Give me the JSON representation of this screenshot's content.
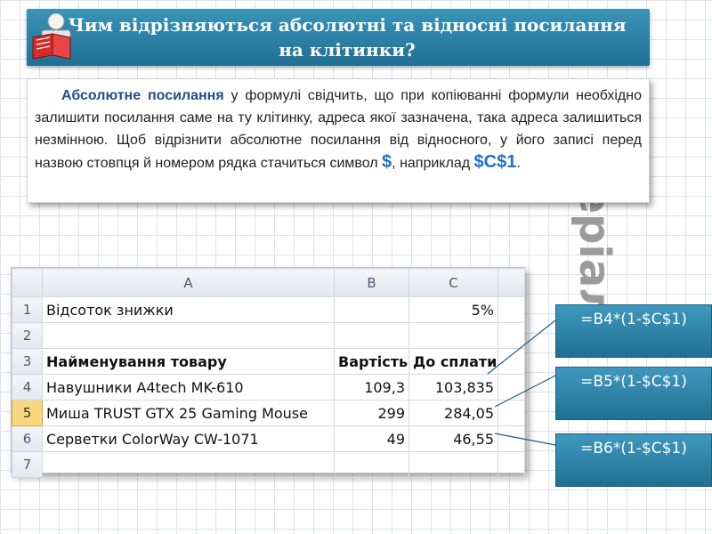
{
  "title": "Чим відрізняються абсолютні та відносні посилання на клітинки?",
  "side_label": "матеріалу",
  "definition": {
    "term": "Абсолютне посилання",
    "text1": " у формулі свідчить, що при копіюванні формули необхідно залишити посилання саме на ту клітинку, адреса якої зазначена, така адреса залишиться незмінною. Щоб відрізнити абсолютне посилання від відносного, у його записі перед назвою стовпця й номером рядка стачиться символ ",
    "symbol": "$",
    "text2": ", наприклад ",
    "example": "$C$1",
    "text3": "."
  },
  "spreadsheet": {
    "columns": [
      "A",
      "B",
      "C"
    ],
    "rows": [
      {
        "num": "1",
        "a": "Відсоток знижки",
        "b": "",
        "c": "5%"
      },
      {
        "num": "2",
        "a": "",
        "b": "",
        "c": ""
      },
      {
        "num": "3",
        "a": "Найменування товару",
        "b": "Вартість",
        "c": "До сплати"
      },
      {
        "num": "4",
        "a": "Навушники A4tech MK-610",
        "b": "109,3",
        "c": "103,835"
      },
      {
        "num": "5",
        "a": "Миша TRUST GTX 25 Gaming Mouse",
        "b": "299",
        "c": "284,05"
      },
      {
        "num": "6",
        "a": "Серветки ColorWay CW-1071",
        "b": "49",
        "c": "46,55"
      },
      {
        "num": "7",
        "a": "",
        "b": "",
        "c": ""
      }
    ],
    "active_row": "5"
  },
  "formulas": [
    "=B4*(1-$C$1)",
    "=B5*(1-$C$1)",
    "=B6*(1-$C$1)"
  ],
  "colors": {
    "title_bar": "#2a82a9",
    "formula_box": "#2a84ab",
    "term": "#1f4e8c",
    "symbol": "#1f6fd0",
    "active_row_header": "#f9d77e"
  },
  "icons": [
    "book-icon"
  ]
}
